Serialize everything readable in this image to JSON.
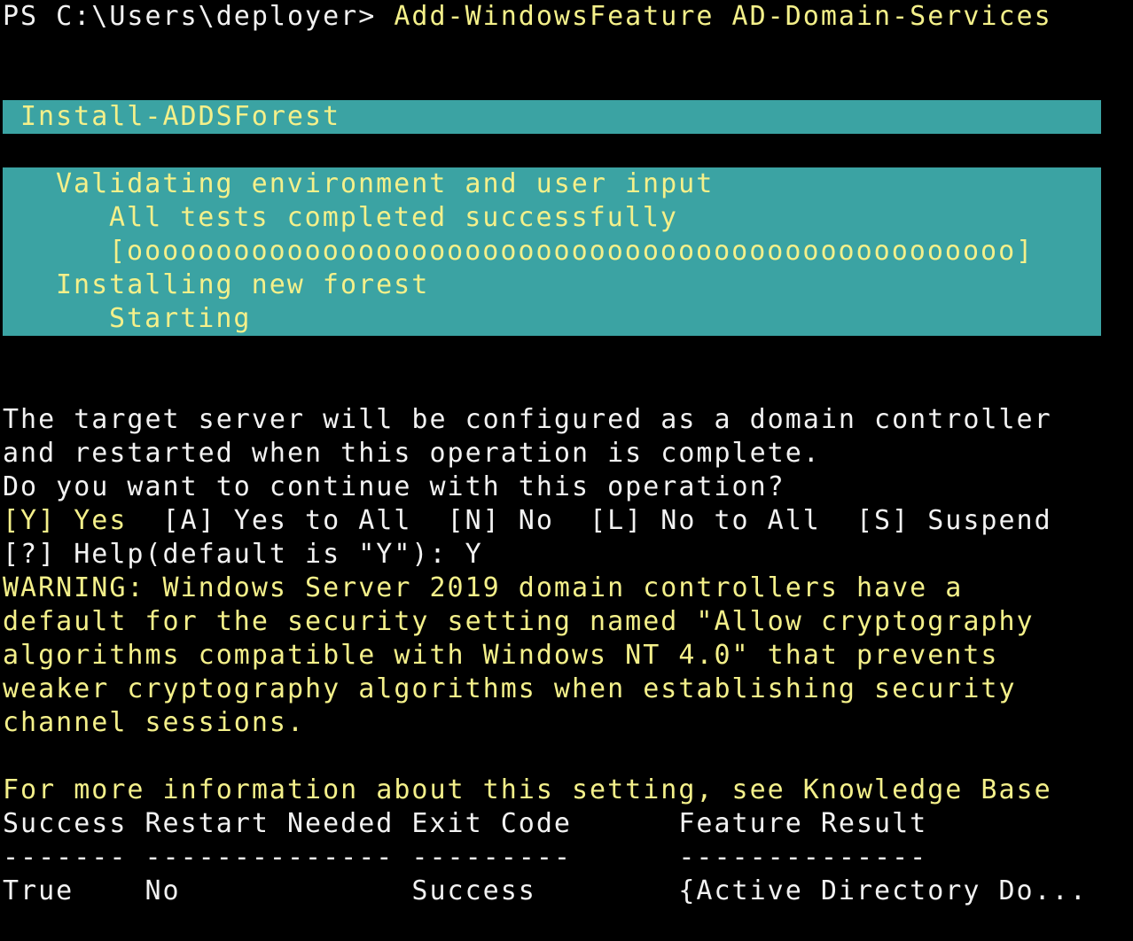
{
  "colors": {
    "background": "#000000",
    "text": "#f2f2f2",
    "highlight_text": "#f4f08a",
    "progress_background": "#3ba3a3"
  },
  "prompt": {
    "prefix": "PS C:\\Users\\deployer> ",
    "command": "Add-WindowsFeature AD-Domain-Services"
  },
  "progress": {
    "title": "Install-ADDSForest",
    "activity1": "Validating environment and user input",
    "status1": "All tests completed successfully",
    "bar": "[oooooooooooooooooooooooooooooooooooooooooooooooooo]",
    "activity2": "Installing new forest",
    "status2": "Starting"
  },
  "confirm": {
    "line1": "The target server will be configured as a domain controller",
    "line2": "and restarted when this operation is complete.",
    "question": "Do you want to continue with this operation?",
    "option_yes": "[Y] Yes",
    "other_options": "  [A] Yes to All  [N] No  [L] No to All  [S] Suspend",
    "help_prompt": "[?] Help(default is \"Y\"): ",
    "answer": "Y"
  },
  "warning": {
    "lines": [
      "WARNING: Windows Server 2019 domain controllers have a",
      "default for the security setting named \"Allow cryptography",
      "algorithms compatible with Windows NT 4.0\" that prevents",
      "weaker cryptography algorithms when establishing security",
      "channel sessions."
    ],
    "more_info": "For more information about this setting, see Knowledge Base"
  },
  "result_table": {
    "header": "Success Restart Needed Exit Code      Feature Result",
    "separator": "------- -------------- ---------      --------------",
    "row": "True    No             Success        {Active Directory Do..."
  }
}
